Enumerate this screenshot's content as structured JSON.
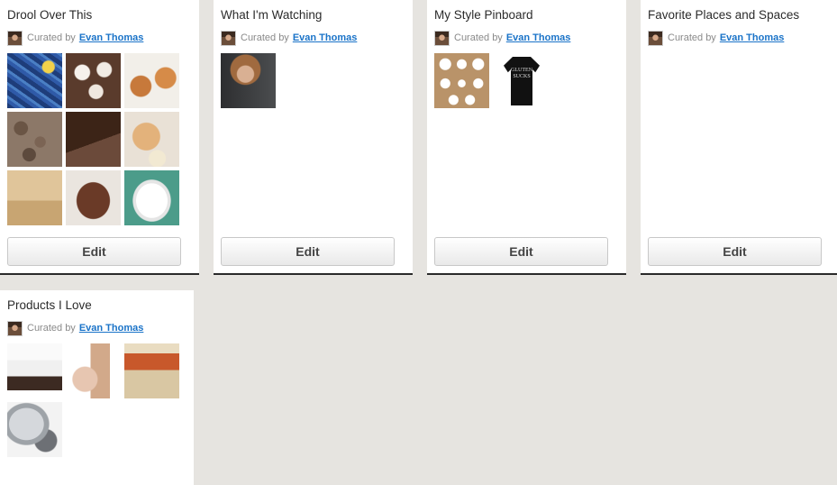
{
  "curated_label": "Curated by",
  "curator_name": "Evan Thomas",
  "edit_label": "Edit",
  "boards": [
    {
      "title": "Drool Over This"
    },
    {
      "title": "What I'm Watching"
    },
    {
      "title": "My Style Pinboard"
    },
    {
      "title": "Favorite Places and Spaces"
    },
    {
      "title": "Products I Love"
    }
  ],
  "shirt_text": "GLUTEN SUCKS",
  "colors": {
    "link": "#1a73c8",
    "background": "#e6e4e0",
    "card": "#ffffff"
  }
}
